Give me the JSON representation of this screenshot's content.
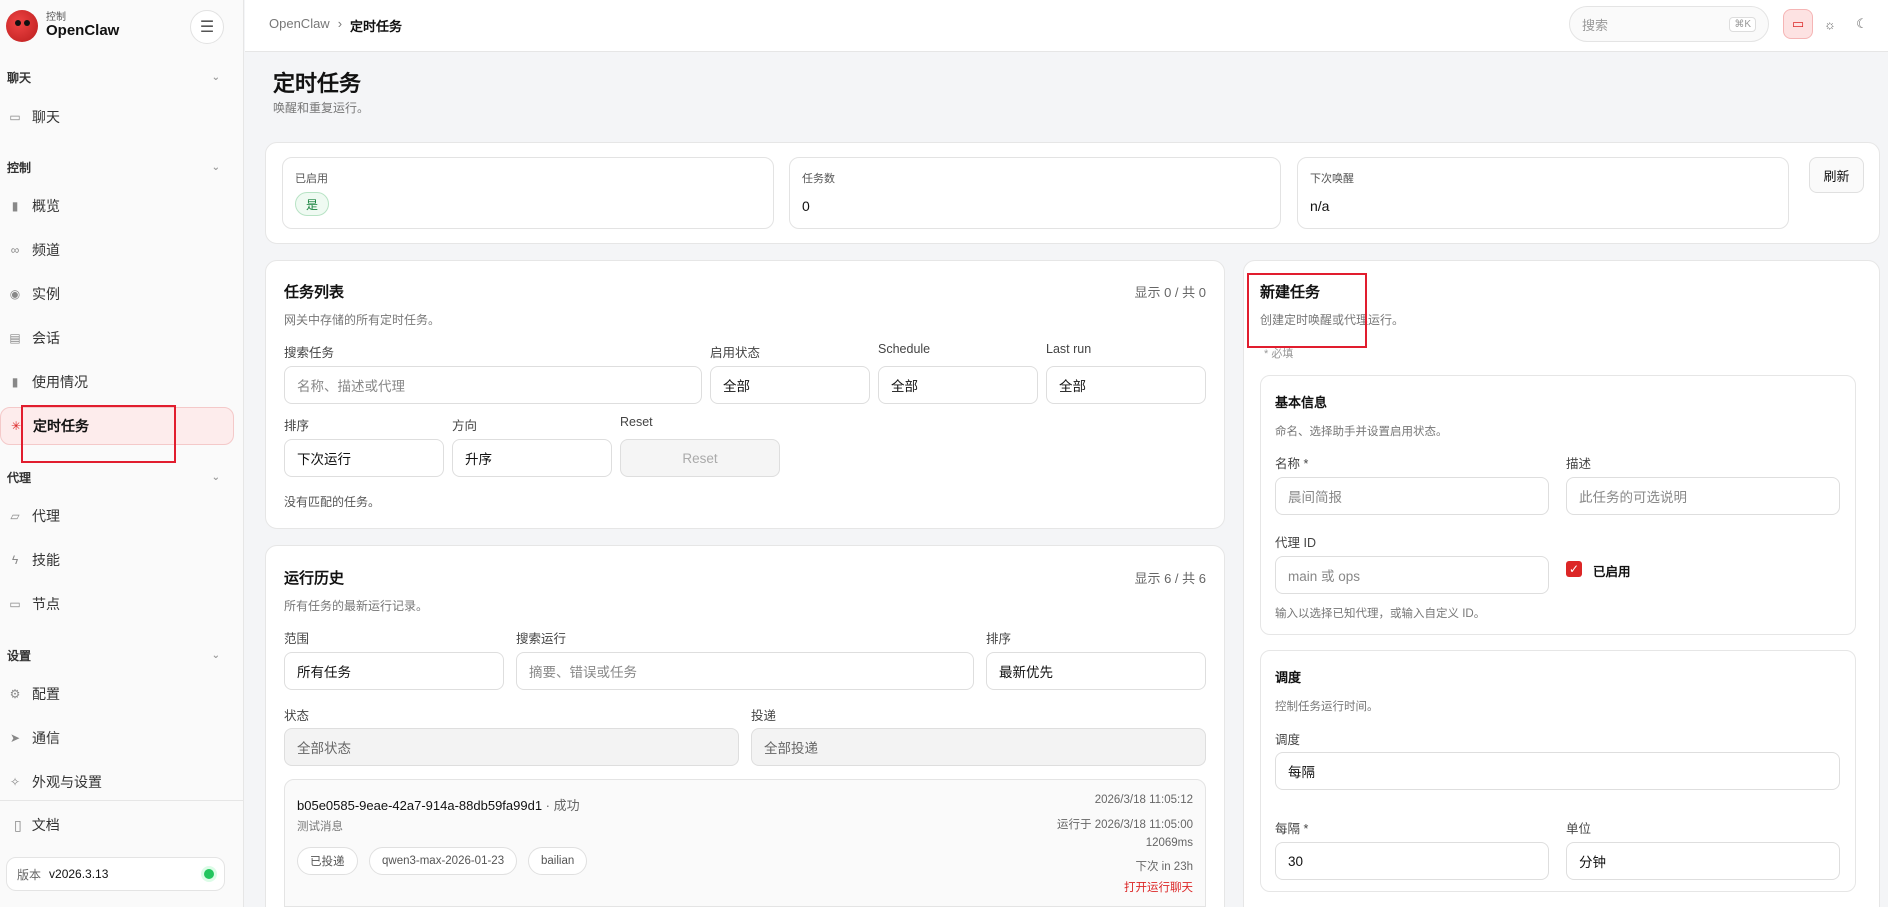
{
  "brand": {
    "sub": "控制",
    "name": "OpenClaw"
  },
  "sidebar": {
    "groups": [
      {
        "label": "聊天",
        "items": [
          {
            "label": "聊天",
            "icon": "chat-icon"
          }
        ]
      },
      {
        "label": "控制",
        "items": [
          {
            "label": "概览",
            "icon": "bar-chart-icon"
          },
          {
            "label": "频道",
            "icon": "link-icon"
          },
          {
            "label": "实例",
            "icon": "radio-icon"
          },
          {
            "label": "会话",
            "icon": "document-icon"
          },
          {
            "label": "使用情况",
            "icon": "bar-chart-icon"
          },
          {
            "label": "定时任务",
            "icon": "loader-icon",
            "active": true
          }
        ]
      },
      {
        "label": "代理",
        "items": [
          {
            "label": "代理",
            "icon": "folder-icon"
          },
          {
            "label": "技能",
            "icon": "zap-icon"
          },
          {
            "label": "节点",
            "icon": "monitor-icon"
          }
        ]
      },
      {
        "label": "设置",
        "items": [
          {
            "label": "配置",
            "icon": "gear-icon"
          },
          {
            "label": "通信",
            "icon": "send-icon"
          },
          {
            "label": "外观与设置",
            "icon": "sparkle-icon"
          }
        ]
      }
    ],
    "docs": "文档",
    "version_label": "版本",
    "version": "v2026.3.13"
  },
  "topbar": {
    "breadcrumb_root": "OpenClaw",
    "breadcrumb_sep": "›",
    "breadcrumb_current": "定时任务",
    "search_placeholder": "搜索",
    "search_kbd": "⌘K"
  },
  "page": {
    "title": "定时任务",
    "subtitle": "唤醒和重复运行。"
  },
  "stats": {
    "enabled_label": "已启用",
    "enabled_value": "是",
    "jobs_label": "任务数",
    "jobs_value": "0",
    "next_label": "下次唤醒",
    "next_value": "n/a",
    "refresh": "刷新"
  },
  "jobs": {
    "title": "任务列表",
    "subtitle": "网关中存储的所有定时任务。",
    "count": "显示 0 / 共 0",
    "search_label": "搜索任务",
    "search_placeholder": "名称、描述或代理",
    "status_label": "启用状态",
    "status_value": "全部",
    "schedule_label": "Schedule",
    "schedule_value": "全部",
    "lastrun_label": "Last run",
    "lastrun_value": "全部",
    "sort_label": "排序",
    "sort_value": "下次运行",
    "dir_label": "方向",
    "dir_value": "升序",
    "reset_label": "Reset",
    "reset_button": "Reset",
    "empty": "没有匹配的任务。"
  },
  "history": {
    "title": "运行历史",
    "subtitle": "所有任务的最新运行记录。",
    "count": "显示 6 / 共 6",
    "scope_label": "范围",
    "scope_value": "所有任务",
    "search_label": "搜索运行",
    "search_placeholder": "摘要、错误或任务",
    "sort_label": "排序",
    "sort_value": "最新优先",
    "status_label": "状态",
    "status_value": "全部状态",
    "delivery_label": "投递",
    "delivery_value": "全部投递",
    "run": {
      "id": "b05e0585-9eae-42a7-914a-88db59fa99d1",
      "status": " · 成功",
      "message": "测试消息",
      "tags": [
        "已投递",
        "qwen3-max-2026-01-23",
        "bailian"
      ],
      "time": "2026/3/18 11:05:12",
      "ran_at": "运行于 2026/3/18 11:05:00",
      "duration": "12069ms",
      "next": "下次 in 23h",
      "open_link": "打开运行聊天"
    }
  },
  "new_job": {
    "title": "新建任务",
    "subtitle": "创建定时唤醒或代理运行。",
    "required_note": "* 必填",
    "basic": {
      "title": "基本信息",
      "subtitle": "命名、选择助手并设置启用状态。",
      "name_label": "名称 *",
      "name_placeholder": "晨间简报",
      "desc_label": "描述",
      "desc_placeholder": "此任务的可选说明",
      "agent_label": "代理 ID",
      "agent_placeholder": "main 或 ops",
      "enabled_label": "已启用",
      "agent_hint": "输入以选择已知代理，或输入自定义 ID。"
    },
    "schedule": {
      "title": "调度",
      "subtitle": "控制任务运行时间。",
      "type_label": "调度",
      "type_value": "每隔",
      "every_label": "每隔 *",
      "every_value": "30",
      "unit_label": "单位",
      "unit_value": "分钟"
    }
  },
  "colors": {
    "accent": "#dc2626",
    "success": "#16803c",
    "annotation": "#e11d2e"
  }
}
